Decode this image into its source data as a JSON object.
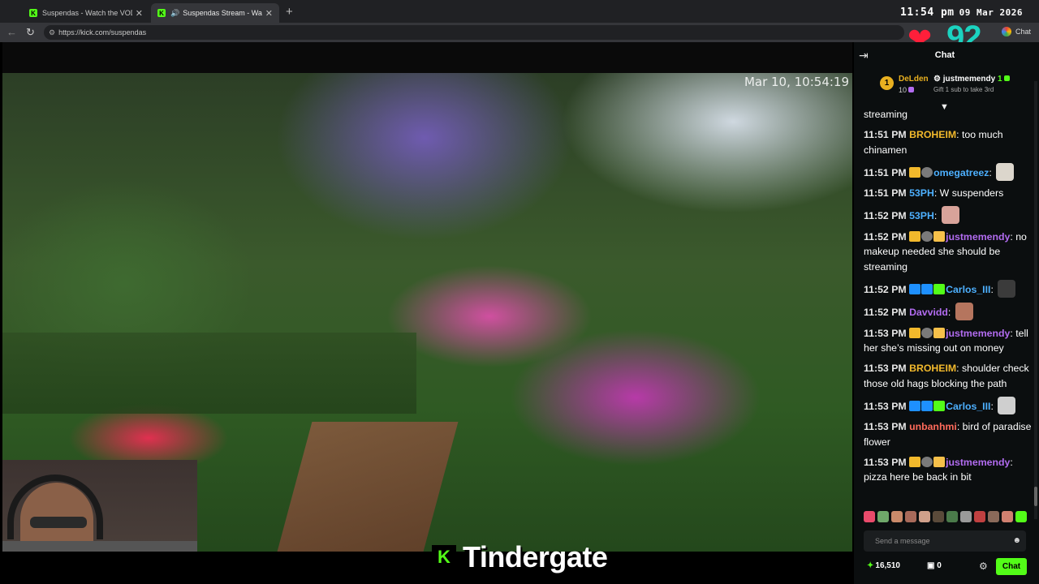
{
  "browser": {
    "tabs": [
      {
        "title": "Suspendas - Watch the VOD on K",
        "icon": "kick-favicon"
      },
      {
        "title": "Suspendas Stream - Watch Li",
        "icon": "kick-favicon",
        "audio": "speaker-icon"
      }
    ],
    "url": "https://kick.com/suspendas",
    "extension_label": "Chat",
    "new_tab": "+",
    "close": "✕"
  },
  "clock": {
    "time": "11:54 pm",
    "date": "09 Mar 2026"
  },
  "overlay": {
    "viewers": "92",
    "heart_color": "#ff1f3a",
    "viewers_color": "#1bd3c0"
  },
  "video": {
    "timestamp": "Mar 10, 10:54:19",
    "ticker_logo": "K",
    "ticker_text": "Tindergate"
  },
  "chat": {
    "title": "Chat",
    "leaderboard": {
      "first": {
        "rank": "1",
        "name": "DeLden",
        "count": "10"
      },
      "second": {
        "name": "justmemendy",
        "count": "1",
        "note": "Gift 1 sub to take 3rd"
      }
    },
    "partial_top": "streaming",
    "messages": [
      {
        "time": "11:51 PM",
        "user": "BROHEIM",
        "color": "u-gold",
        "badges": [],
        "text": "too much chinamen",
        "emote": ""
      },
      {
        "time": "11:51 PM",
        "user": "omegatreez",
        "color": "u-blue",
        "badges": [
          "b-crown",
          "b-grey"
        ],
        "text": "",
        "emote": "e-cat"
      },
      {
        "time": "11:51 PM",
        "user": "53PH",
        "color": "u-blue",
        "badges": [],
        "text": "W suspenders",
        "emote": ""
      },
      {
        "time": "11:52 PM",
        "user": "53PH",
        "color": "u-blue",
        "badges": [],
        "text": "",
        "emote": "e-pig"
      },
      {
        "time": "11:52 PM",
        "user": "justmemendy",
        "color": "u-purple",
        "badges": [
          "b-crown",
          "b-grey",
          "b-gift"
        ],
        "text": "no makeup needed she should be streaming",
        "emote": ""
      },
      {
        "time": "11:52 PM",
        "user": "Carlos_III",
        "color": "u-blue",
        "badges": [
          "b-blue",
          "b-blue",
          "b-green"
        ],
        "text": "",
        "emote": "e-sus"
      },
      {
        "time": "11:52 PM",
        "user": "Davvidd",
        "color": "u-purple",
        "badges": [],
        "text": "",
        "emote": "e-face"
      },
      {
        "time": "11:53 PM",
        "user": "justmemendy",
        "color": "u-purple",
        "badges": [
          "b-crown",
          "b-grey",
          "b-gift"
        ],
        "text": "tell her she’s missing out on money",
        "emote": ""
      },
      {
        "time": "11:53 PM",
        "user": "BROHEIM",
        "color": "u-gold",
        "badges": [],
        "text": "shoulder check those old hags blocking the path",
        "emote": ""
      },
      {
        "time": "11:53 PM",
        "user": "Carlos_III",
        "color": "u-blue",
        "badges": [
          "b-blue",
          "b-blue",
          "b-green"
        ],
        "text": "",
        "emote": "e-anime"
      },
      {
        "time": "11:53 PM",
        "user": "unbanhmi",
        "color": "u-red",
        "badges": [],
        "text": "bird of paradise flower",
        "emote": ""
      },
      {
        "time": "11:53 PM",
        "user": "justmemendy",
        "color": "u-purple",
        "badges": [
          "b-crown",
          "b-grey",
          "b-gift"
        ],
        "text": "pizza here be back in bit",
        "emote": ""
      }
    ],
    "emote_bar_colors": [
      "#e94b6b",
      "#6fa86a",
      "#c98a6a",
      "#a86a5a",
      "#d0a08a",
      "#5a4a3a",
      "#4a7a4a",
      "#9a9a9a",
      "#c04040",
      "#8a6a5a",
      "#d08070",
      "#53fc18"
    ],
    "input_placeholder": "Send a message",
    "points": "16,510",
    "gifts": "0",
    "send_label": "Chat"
  }
}
